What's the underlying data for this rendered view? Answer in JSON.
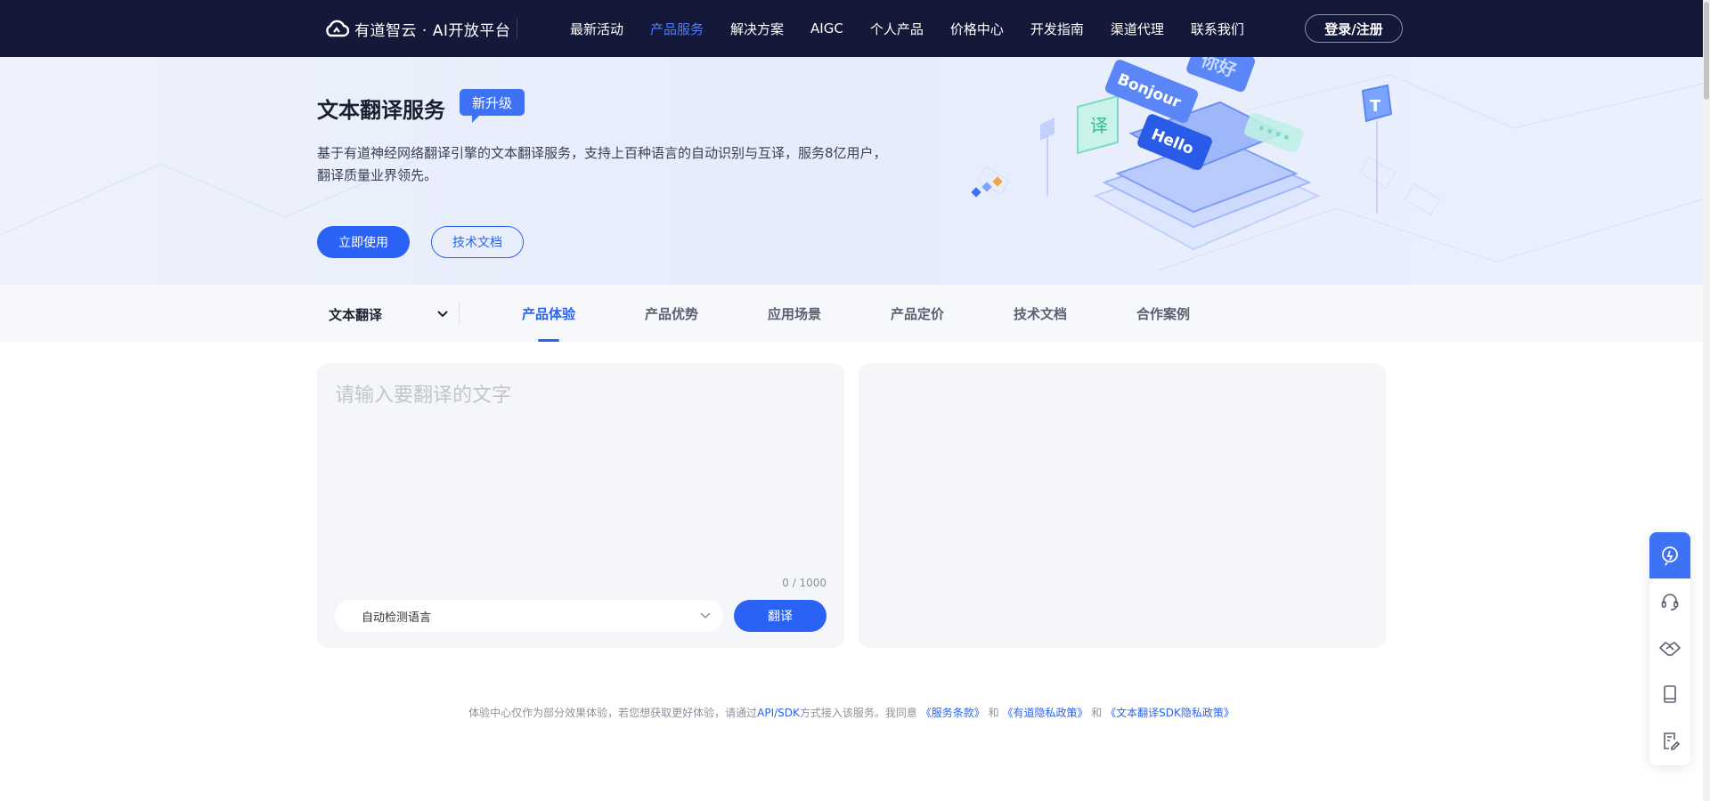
{
  "header": {
    "logo_text": "有道智云 · AI开放平台",
    "nav": [
      {
        "label": "最新活动",
        "active": false
      },
      {
        "label": "产品服务",
        "active": true
      },
      {
        "label": "解决方案",
        "active": false
      },
      {
        "label": "AIGC",
        "active": false
      },
      {
        "label": "个人产品",
        "active": false
      },
      {
        "label": "价格中心",
        "active": false
      },
      {
        "label": "开发指南",
        "active": false
      },
      {
        "label": "渠道代理",
        "active": false
      },
      {
        "label": "联系我们",
        "active": false
      }
    ],
    "login_label": "登录/注册"
  },
  "hero": {
    "title": "文本翻译服务",
    "badge": "新升级",
    "description": "基于有道神经网络翻译引擎的文本翻译服务，支持上百种语言的自动识别与互译，服务8亿用户，翻译质量业界领先。",
    "primary_button": "立即使用",
    "secondary_button": "技术文档",
    "illustration_words": [
      "Bonjour",
      "你好",
      "Hello",
      "译",
      "T"
    ]
  },
  "tabbar": {
    "product_select": "文本翻译",
    "tabs": [
      {
        "label": "产品体验",
        "active": true
      },
      {
        "label": "产品优势",
        "active": false
      },
      {
        "label": "应用场景",
        "active": false
      },
      {
        "label": "产品定价",
        "active": false
      },
      {
        "label": "技术文档",
        "active": false
      },
      {
        "label": "合作案例",
        "active": false
      }
    ]
  },
  "translator": {
    "input_placeholder": "请输入要翻译的文字",
    "input_value": "",
    "char_count": "0 / 1000",
    "language_select": "自动检测语言",
    "translate_button": "翻译",
    "output_value": ""
  },
  "disclaimer": {
    "prefix": "体验中心仅作为部分效果体验，若您想获取更好体验，请通过",
    "api_link": "API/SDK",
    "middle": "方式接入该服务。我同意",
    "link_terms": "《服务条款》",
    "and1": "和",
    "link_privacy": "《有道隐私政策》",
    "and2": "和",
    "link_sdk_privacy": "《文本翻译SDK隐私政策》"
  },
  "side_toolbar": {
    "icons": [
      "ai-assistant-icon",
      "headset-icon",
      "handshake-icon",
      "tablet-icon",
      "edit-document-icon"
    ]
  },
  "colors": {
    "nav_bg": "#14193a",
    "accent": "#2962f5",
    "active_nav": "#4f7bff",
    "hero_bg": "#eaf0fd",
    "panel_bg": "#f5f6fa"
  }
}
